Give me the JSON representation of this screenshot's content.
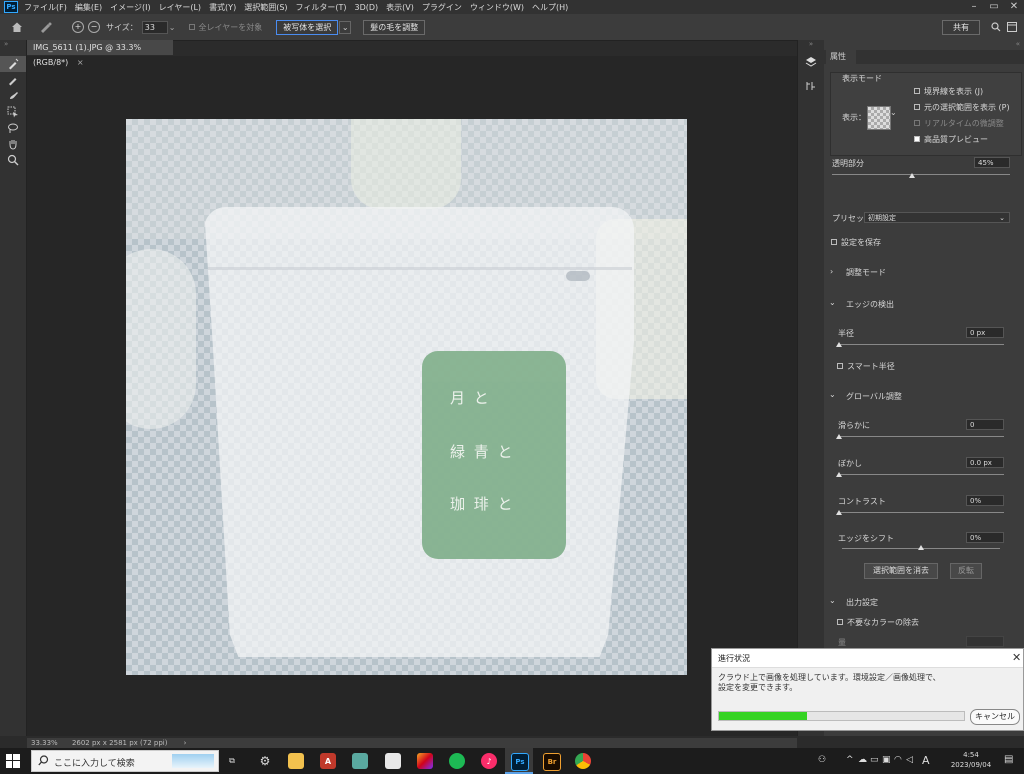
{
  "app": {
    "logo": "Ps",
    "accent": "#31a8ff"
  },
  "menu": [
    "ファイル(F)",
    "編集(E)",
    "イメージ(I)",
    "レイヤー(L)",
    "書式(Y)",
    "選択範囲(S)",
    "フィルター(T)",
    "3D(D)",
    "表示(V)",
    "プラグイン",
    "ウィンドウ(W)",
    "ヘルプ(H)"
  ],
  "window_controls": {
    "minimize": "–",
    "restore": "▭",
    "close": "✕"
  },
  "options": {
    "size_label": "サイズ：",
    "size_value": "33",
    "sample_all_label": "全レイヤーを対象",
    "select_subject": "被写体を選択",
    "refine_hair": "髪の毛を調整",
    "share": "共有"
  },
  "document": {
    "tab_title": "IMG_5611 (1).JPG @ 33.3% (RGB/8*)",
    "zoom": "33.33%",
    "dimensions": "2602 px x 2581 px (72 ppi)"
  },
  "canvas_text": {
    "line1": "月 と",
    "line2": "緑 青 と",
    "line3": "珈 琲 と"
  },
  "panel": {
    "tab": "属性",
    "view_mode_title": "表示モード",
    "view_label": "表示：",
    "show_edge": "境界線を表示 (J)",
    "show_original": "元の選択範囲を表示 (P)",
    "realtime_refine": "リアルタイムの微調整",
    "high_quality_preview": "高品質プレビュー",
    "opacity_label": "透明部分",
    "opacity_value": "45%",
    "opacity_level": 0.45,
    "preset_label": "プリセット",
    "preset_value": "初期設定",
    "save_settings": "設定を保存",
    "adjust_mode": "調整モード",
    "edge_detection": "エッジの検出",
    "radius_label": "半径",
    "radius_value": "0 px",
    "smart_radius": "スマート半径",
    "global_refine": "グローバル調整",
    "smooth_label": "滑らかに",
    "smooth_value": "0",
    "feather_label": "ぼかし",
    "feather_value": "0.0 px",
    "contrast_label": "コントラスト",
    "contrast_value": "0%",
    "shift_edge_label": "エッジをシフト",
    "shift_edge_value": "0%",
    "clear_selection": "選択範囲を消去",
    "invert": "反転",
    "output_settings": "出力設定",
    "decontaminate": "不要なカラーの除去",
    "amount_label": "量"
  },
  "dialog": {
    "title": "進行状況",
    "message": "クラウド上で画像を処理しています。環境設定／画像処理で、設定を変更できます。",
    "cancel": "キャンセル",
    "progress": 0.36,
    "bar_color": "#34d322"
  },
  "taskbar": {
    "search_placeholder": "ここに入力して検索",
    "time": "4:54",
    "date": "2023/09/04",
    "ime": "A"
  }
}
